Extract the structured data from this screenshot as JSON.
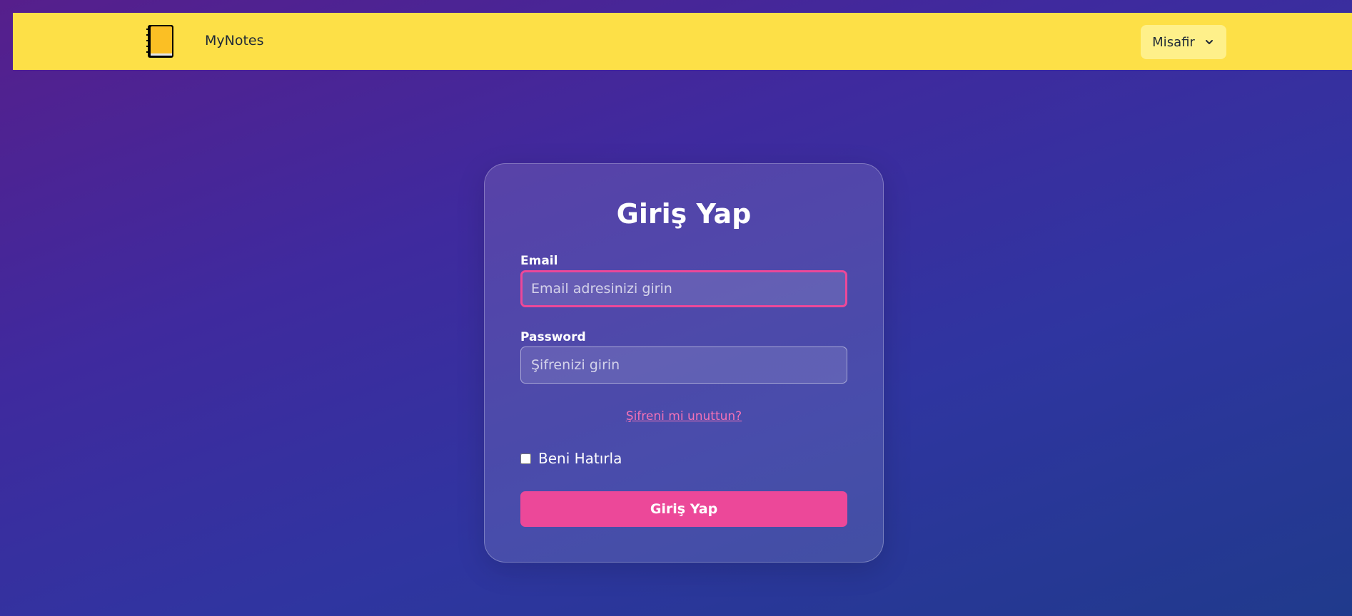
{
  "navbar": {
    "brand": "MyNotes",
    "logo_icon": "notebook-icon",
    "user_menu": {
      "label": "Misafir",
      "icon": "chevron-down-icon"
    }
  },
  "login": {
    "title": "Giriş Yap",
    "email": {
      "label": "Email",
      "placeholder": "Email adresinizi girin",
      "value": ""
    },
    "password": {
      "label": "Password",
      "placeholder": "Şifrenizi girin",
      "value": ""
    },
    "forgot_password": "Şifreni mi unuttun?",
    "remember_me": {
      "label": "Beni Hatırla",
      "checked": false
    },
    "submit_label": "Giriş Yap"
  },
  "colors": {
    "navbar_bg": "#fde047",
    "user_menu_bg": "#fef08a",
    "accent": "#ec4899",
    "link": "#f472b6"
  }
}
